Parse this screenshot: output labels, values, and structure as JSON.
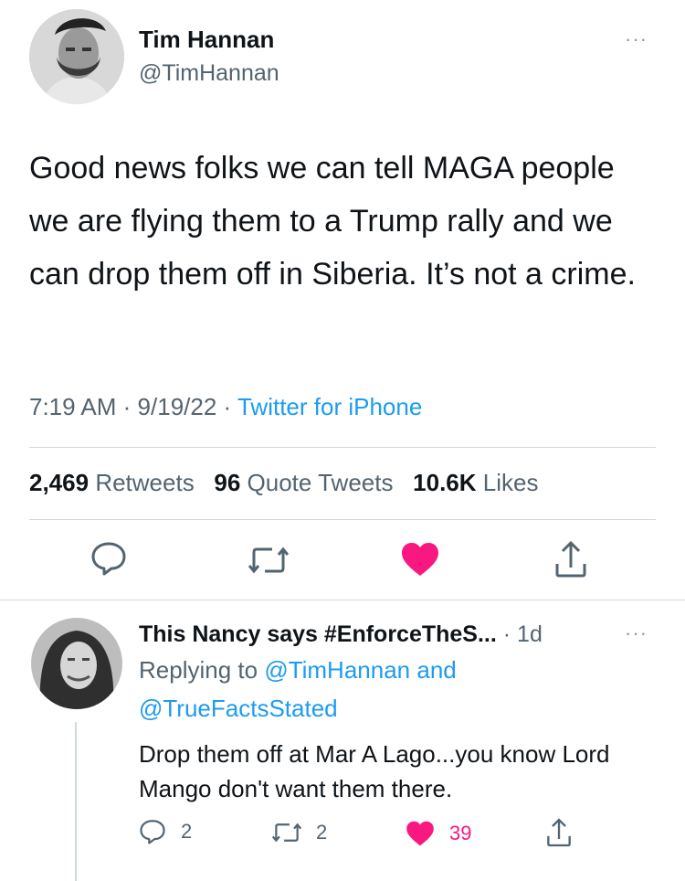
{
  "tweet": {
    "author_name": "Tim Hannan",
    "author_handle": "@TimHannan",
    "more": "···",
    "text": "Good news folks we can tell MAGA people we are flying them to a Trump rally and we can drop them off in Siberia. It’s not a crime.",
    "time": "7:19 AM",
    "date": "9/19/22",
    "separator": "·",
    "source": "Twitter for iPhone",
    "stats": {
      "retweets_count": "2,469",
      "retweets_label": "Retweets",
      "quotes_count": "96",
      "quotes_label": "Quote Tweets",
      "likes_count": "10.6K",
      "likes_label": "Likes"
    },
    "actions": [
      "reply-icon",
      "retweet-icon",
      "like-icon-filled",
      "share-icon"
    ],
    "like_color": "#f91880"
  },
  "reply": {
    "author_name": "This Nancy says #EnforceTheS...",
    "time": "· 1d",
    "more": "···",
    "replying_prefix": "Replying to",
    "replying_handle_1": "@TimHannan",
    "replying_and": "and",
    "replying_handle_2": "@TrueFactsStated",
    "text": "Drop them off at Mar A Lago...you know Lord Mango don't want them there.",
    "reply_count": "2",
    "retweet_count": "2",
    "like_count": "39"
  },
  "colors": {
    "link": "#1d9bf0",
    "secondary_text": "#536471",
    "like": "#f91880",
    "divider": "#cfd9de"
  }
}
